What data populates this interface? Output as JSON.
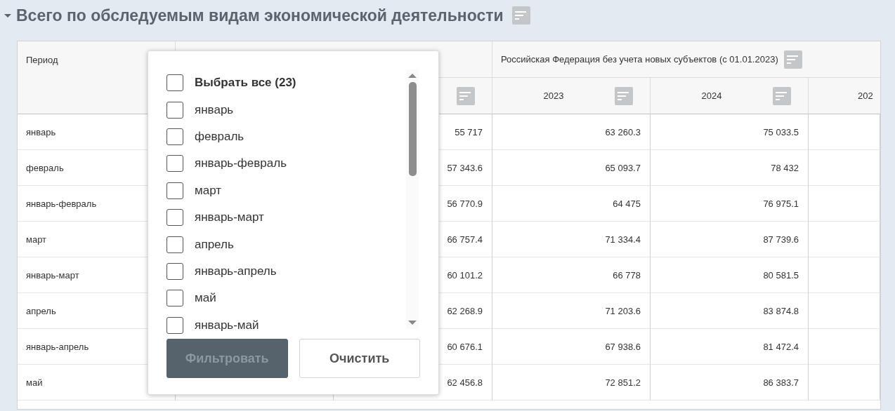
{
  "section": {
    "title": "Всего по обследуемым видам экономической деятельности",
    "expanded": true
  },
  "table": {
    "period_header": "Период",
    "group_header": "Российская Федерация без учета новых субъектов (с 01.01.2023)",
    "columns": [
      {
        "label": "2023"
      },
      {
        "label": "2024"
      },
      {
        "label": "202"
      }
    ],
    "rows": [
      {
        "period": "январь",
        "column_3": "55 717",
        "values": [
          "63 260.3",
          "75 033.5"
        ]
      },
      {
        "period": "февраль",
        "column_3": "57 343.6",
        "values": [
          "65 093.7",
          "78 432"
        ]
      },
      {
        "period": "январь-февраль",
        "column_3": "56 770.9",
        "values": [
          "64 475",
          "76 975.1"
        ]
      },
      {
        "period": "март",
        "column_3": "66 757.4",
        "values": [
          "71 334.4",
          "87 739.6"
        ]
      },
      {
        "period": "январь-март",
        "column_3": "60 101.2",
        "values": [
          "66 778",
          "80 581.5"
        ]
      },
      {
        "period": "апрель",
        "column_3": "62 268.9",
        "values": [
          "71 203.6",
          "83 874.8"
        ]
      },
      {
        "period": "январь-апрель",
        "column_3": "60 676.1",
        "values": [
          "67 938.6",
          "81 472.4"
        ]
      },
      {
        "period": "май",
        "column_3": "62 456.8",
        "values": [
          "72 851.2",
          "86 383.7"
        ]
      }
    ]
  },
  "filter_popup": {
    "select_all": {
      "label": "Выбрать все (23)",
      "checked": false
    },
    "options": [
      {
        "label": "январь",
        "checked": false
      },
      {
        "label": "февраль",
        "checked": false
      },
      {
        "label": "январь-февраль",
        "checked": false
      },
      {
        "label": "март",
        "checked": false
      },
      {
        "label": "январь-март",
        "checked": false
      },
      {
        "label": "апрель",
        "checked": false
      },
      {
        "label": "январь-апрель",
        "checked": false
      },
      {
        "label": "май",
        "checked": false
      },
      {
        "label": "январь-май",
        "checked": false
      }
    ],
    "buttons": [
      {
        "label": "Фильтровать",
        "kind": "primary",
        "disabled": true
      },
      {
        "label": "Очистить",
        "kind": "secondary",
        "disabled": false
      }
    ]
  }
}
